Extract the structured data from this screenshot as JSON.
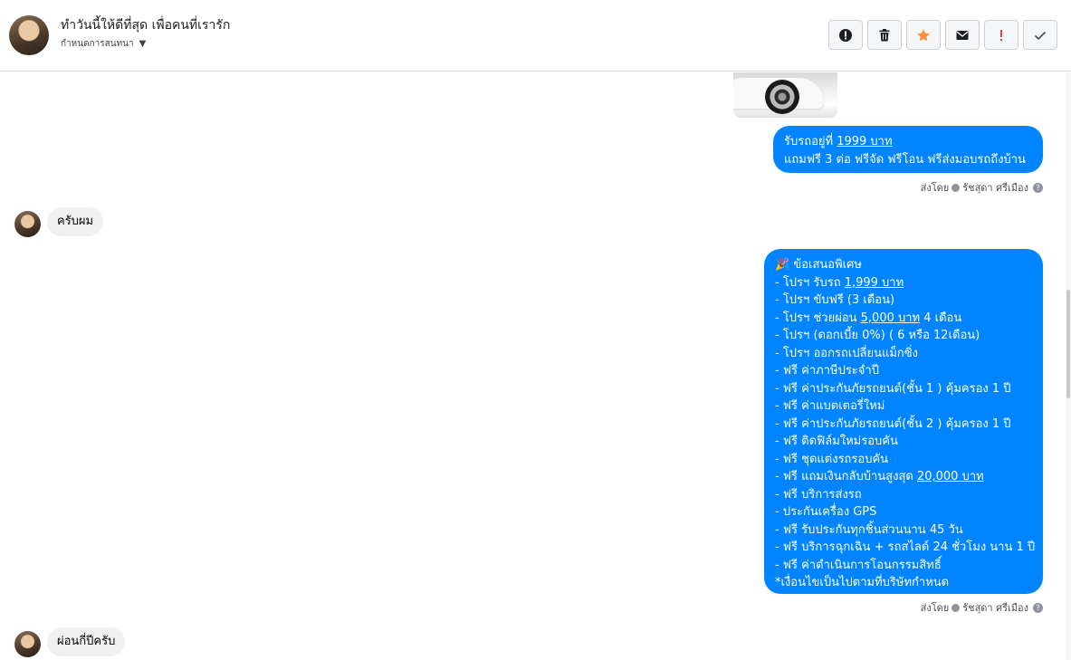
{
  "header": {
    "title": "ทำวันนี้ให้ดีที่สุด เพื่อคนที่เรารัก",
    "subtitle": "กำหนดการสนทนา"
  },
  "toolbar": {
    "buttons": [
      {
        "icon": "alert-circle-icon"
      },
      {
        "icon": "trash-icon"
      },
      {
        "icon": "star-icon",
        "color": "#f7923a"
      },
      {
        "icon": "mail-icon"
      },
      {
        "icon": "exclamation-icon",
        "color": "#fa383e"
      },
      {
        "icon": "check-icon"
      }
    ]
  },
  "messages": {
    "msg1": {
      "line1_prefix": "รับรถอยู่ที่ ",
      "line1_price": "1999 บาท",
      "line2": "แถมฟรี 3 ต่อ ฟรีจัด ฟรีโอน  ฟรีส่งมอบรถถึงบ้าน"
    },
    "sent_by_label": "ส่งโดย",
    "sender_name": "รัชสุดา ศรีเมือง",
    "reply1": "ครับผม",
    "msg2": {
      "l1": "🎉 ข้อเสนอพิเศษ",
      "l2_pre": "- โปรฯ รับรถ ",
      "l2_u": "1,999 บาท",
      "l3": "- โปรฯ ขับฟรี (3 เดือน)",
      "l4_pre": "- โปรฯ ช่วยผ่อน ",
      "l4_u": "5,000 บาท",
      "l4_post": " 4 เดือน",
      "l5": "- โปรฯ (ดอกเบี้ย 0%) ( 6 หรือ 12เดือน)",
      "l6": "- โปรฯ ออกรถเปลี่ยนแม็กซิ่ง",
      "l7": "- ฟรี ค่าภาษีประจำปี",
      "l8": "- ฟรี ค่าประกันภัยรถยนต์(ชั้น 1 ) คุ้มครอง 1 ปี",
      "l9": "- ฟรี ค่าแบตเตอรี่ใหม่",
      "l10": "- ฟรี ค่าประกันภัยรถยนต์(ชั้น 2 ) คุ้มครอง 1 ปี",
      "l11": "- ฟรี ติดฟิล์มใหม่รอบคัน",
      "l12": "- ฟรี ชุดแต่งรถรอบคัน",
      "l13_pre": "- ฟรี แถมเงินกลับบ้านสูงสุด ",
      "l13_u": "20,000 บาท",
      "l14": "- ฟรี บริการส่งรถ",
      "l15": "- ประกันเครื่อง GPS",
      "l16": "- ฟรี รับประกันทุกชิ้นส่วนนาน 45 วัน",
      "l17": "- ฟรี บริการฉุกเฉิน + รถสไลด์ 24 ชั่วโมง นาน 1 ปี",
      "l18": "- ฟรี ค่าดำเนินการโอนกรรมสิทธิ์",
      "l19": "*เงื่อนไขเป็นไปตามที่บริษัทกำหนด"
    },
    "reply2": "ผ่อนกี่ปีครับ",
    "help_glyph": "?"
  }
}
